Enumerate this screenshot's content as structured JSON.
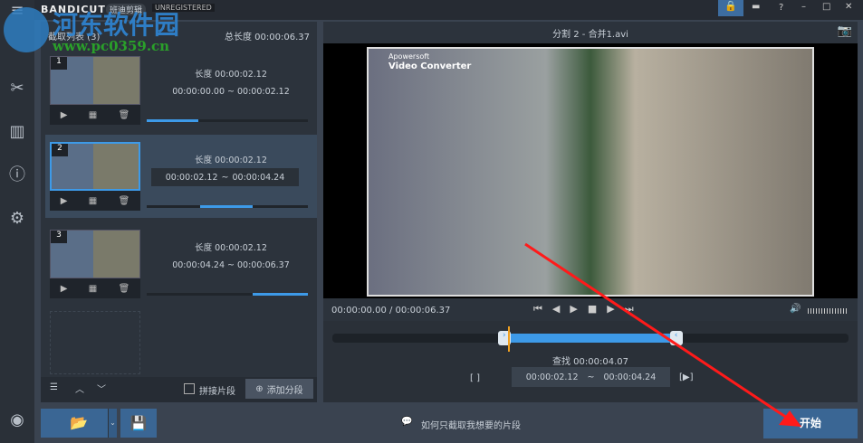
{
  "header": {
    "brand": "BANDICUT",
    "brand_cn": "班迪剪辑",
    "registration": "UNREGISTERED"
  },
  "watermark": {
    "name": "河东软件园",
    "url": "www.pc0359.cn"
  },
  "left": {
    "list_title": "截取列表 (3)",
    "total_label": "总长度 00:00:06.37",
    "clips": [
      {
        "num": "1",
        "length": "长度 00:00:02.12",
        "range": "00:00:00.00 ~ 00:00:02.12",
        "progress": 0.32
      },
      {
        "num": "2",
        "length": "长度 00:00:02.12",
        "start": "00:00:02.12",
        "end": "00:00:04.24",
        "progress_start": 0.33,
        "progress_end": 0.66
      },
      {
        "num": "3",
        "length": "长度 00:00:02.12",
        "range": "00:00:04.24 ~ 00:00:06.37",
        "progress_start": 0.66,
        "progress_end": 1.0
      }
    ],
    "merge_label": "拼接片段",
    "add_label": "添加分段"
  },
  "player": {
    "title": "分割 2 - 合并1.avi",
    "video_text1": "Apowersoft",
    "video_text2": "Video Converter",
    "time": "00:00:00.00 / 00:00:06.37",
    "seek": "查找 00:00:04.07",
    "start": "00:00:02.12",
    "end": "00:00:04.24",
    "tilde": "~",
    "selection_start": 0.333,
    "selection_end": 0.666,
    "playhead": 0.34
  },
  "bottom": {
    "help": "如何只截取我想要的片段",
    "start_button": "开始"
  }
}
